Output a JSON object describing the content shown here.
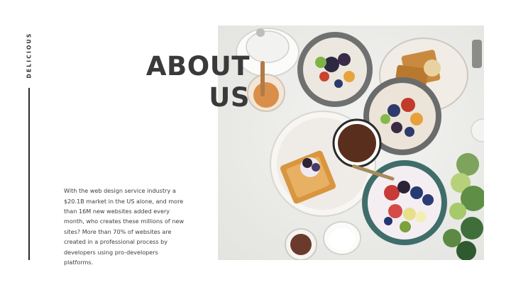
{
  "side_label": "DELICIOUS",
  "title": {
    "line1": "ABOUT",
    "line2": "US"
  },
  "body": "With the web design service industry a $20.1B market in the US alone, and more than 16M new websites added every month, who creates these millions of new sites? More than 70% of websites are created in a professional process by developers using pro-developers platforms.",
  "colors": {
    "title": "#3a3a3a",
    "text": "#3d3d3d",
    "rule": "#2b2b2b",
    "background": "#ffffff"
  },
  "photo": {
    "subject": "food-flatlay-photo"
  }
}
